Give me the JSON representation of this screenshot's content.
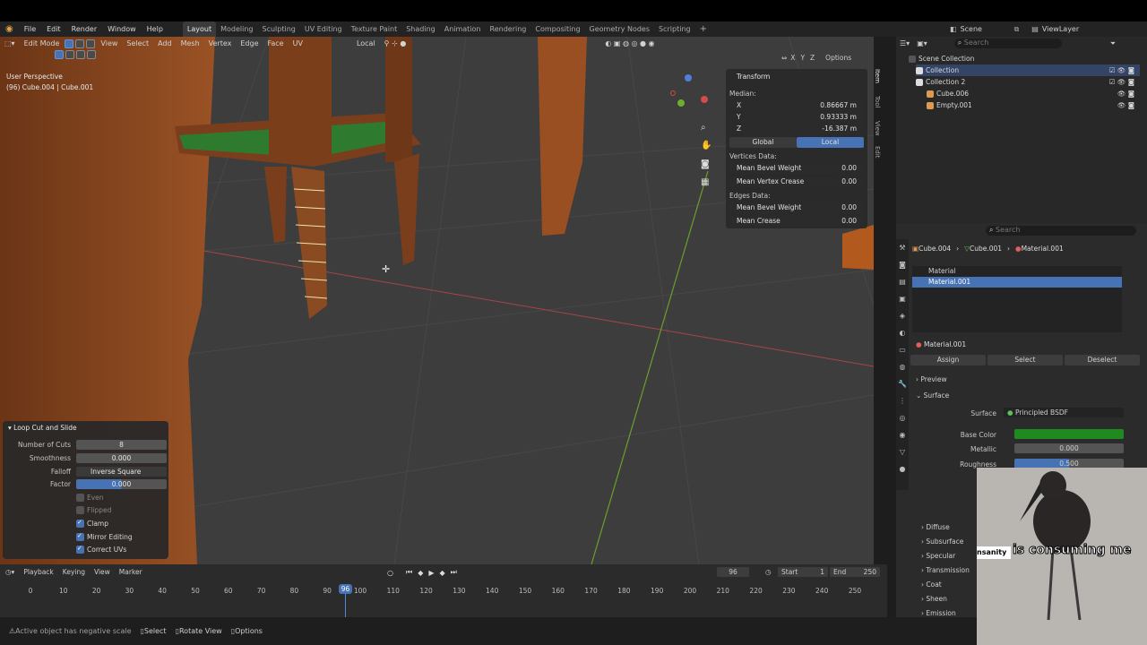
{
  "menu": [
    "File",
    "Edit",
    "Render",
    "Window",
    "Help"
  ],
  "workspaces": [
    "Layout",
    "Modeling",
    "Sculpting",
    "UV Editing",
    "Texture Paint",
    "Shading",
    "Animation",
    "Rendering",
    "Compositing",
    "Geometry Nodes",
    "Scripting"
  ],
  "active_workspace": "Layout",
  "scene_name": "Scene",
  "view_layer": "ViewLayer",
  "viewport_header": {
    "mode": "Edit Mode",
    "menus": [
      "View",
      "Select",
      "Add",
      "Mesh",
      "Vertex",
      "Edge",
      "Face",
      "UV"
    ],
    "orientation": "Local",
    "axes": [
      "X",
      "Y",
      "Z"
    ],
    "options": "Options"
  },
  "viewport_overlay": {
    "perspective": "User Perspective",
    "object_info": "(96) Cube.004 | Cube.001"
  },
  "npanel": {
    "title": "Transform",
    "median": "Median:",
    "x_label": "X",
    "x_val": "0.86667 m",
    "y_label": "Y",
    "y_val": "0.93333 m",
    "z_label": "Z",
    "z_val": "-16.387 m",
    "global": "Global",
    "local": "Local",
    "vertices_data": "Vertices Data:",
    "mean_bevel_weight": "Mean Bevel Weight",
    "mbw_val": "0.00",
    "mean_vertex_crease": "Mean Vertex Crease",
    "mvc_val": "0.00",
    "edges_data": "Edges Data:",
    "mean_bevel_weight_2": "Mean Bevel Weight",
    "mbw2_val": "0.00",
    "mean_crease": "Mean Crease",
    "mc_val": "0.00",
    "tabs": [
      "Item",
      "Tool",
      "View",
      "Edit"
    ]
  },
  "operator_panel": {
    "title": "Loop Cut and Slide",
    "number_of_cuts_label": "Number of Cuts",
    "number_of_cuts": "8",
    "smoothness_label": "Smoothness",
    "smoothness": "0.000",
    "falloff_label": "Falloff",
    "falloff": "Inverse Square",
    "factor_label": "Factor",
    "factor": "0.000",
    "even": "Even",
    "flipped": "Flipped",
    "clamp": "Clamp",
    "mirror_editing": "Mirror Editing",
    "correct_uvs": "Correct UVs"
  },
  "outliner": {
    "search_placeholder": "Search",
    "scene_collection": "Scene Collection",
    "collection": "Collection",
    "collection2": "Collection 2",
    "cube006": "Cube.006",
    "empty001": "Empty.001"
  },
  "properties": {
    "search_placeholder": "Search",
    "breadcrumb": [
      "Cube.004",
      "Cube.001",
      "Material.001"
    ],
    "slots": [
      "Material",
      "Material.001"
    ],
    "material_name": "Material.001",
    "assign": "Assign",
    "select": "Select",
    "deselect": "Deselect",
    "preview": "Preview",
    "surface_section": "Surface",
    "surface_label": "Surface",
    "surface_value": "Principled BSDF",
    "base_color_label": "Base Color",
    "metallic_label": "Metallic",
    "metallic": "0.000",
    "roughness_label": "Roughness",
    "roughness": "0.500",
    "sections": [
      "Diffuse",
      "Subsurface",
      "Specular",
      "Transmission",
      "Coat",
      "Sheen",
      "Emission"
    ]
  },
  "timeline": {
    "menus": [
      "Playback",
      "Keying",
      "View",
      "Marker"
    ],
    "current_frame": "96",
    "start_label": "Start",
    "start": "1",
    "end_label": "End",
    "end": "250",
    "ticks": [
      "0",
      "10",
      "20",
      "30",
      "40",
      "50",
      "60",
      "70",
      "80",
      "90",
      "100",
      "110",
      "120",
      "130",
      "140",
      "150",
      "160",
      "170",
      "180",
      "190",
      "200",
      "210",
      "220",
      "230",
      "240",
      "250"
    ],
    "playhead": "96"
  },
  "statusbar": {
    "warning": "Active object has negative scale",
    "select": "Select",
    "rotate_view": "Rotate View",
    "options": "Options"
  },
  "webcam_caption": {
    "left": "nsanity",
    "right": "is consuming me"
  },
  "colors": {
    "accent": "#4772b3",
    "base_color": "#1f8a1f",
    "wood": "#8a4a22"
  }
}
